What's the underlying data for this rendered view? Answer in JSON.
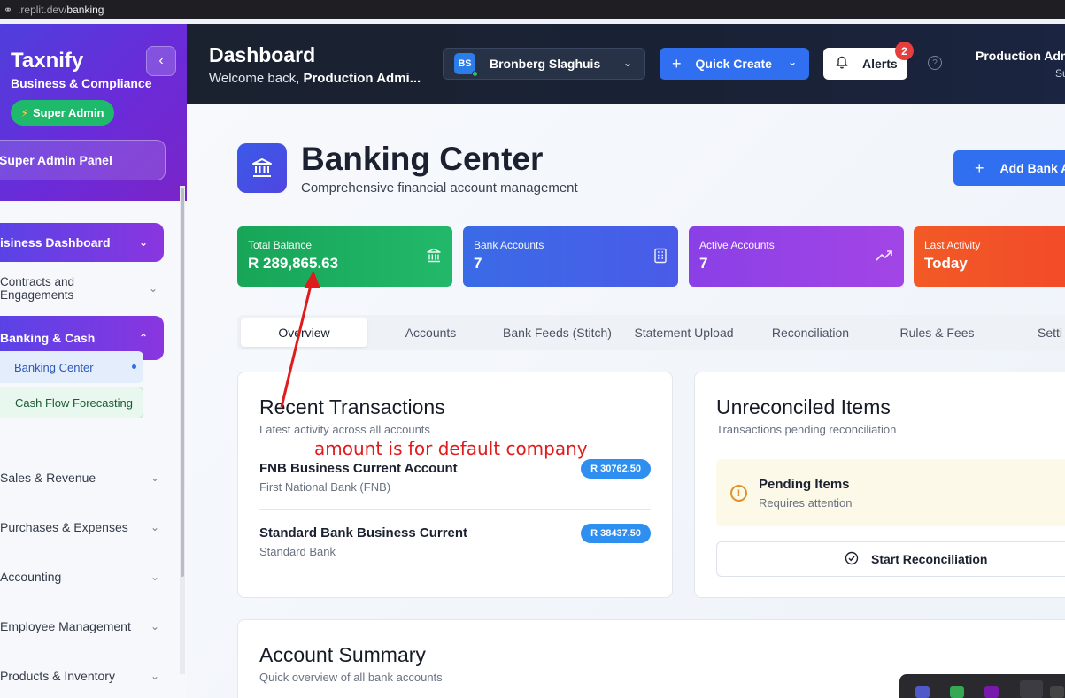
{
  "browser": {
    "url_host": ".replit.dev/",
    "url_path": "banking"
  },
  "sidebar": {
    "brand": "Taxnify",
    "brand_sub": "Business & Compliance",
    "badge": "Super Admin",
    "panel": "Super Admin Panel",
    "items": [
      {
        "label": "isiness Dashboard"
      },
      {
        "label": "Contracts and Engagements"
      },
      {
        "label": "Banking & Cash"
      },
      {
        "label": "Sales & Revenue"
      },
      {
        "label": "Purchases & Expenses"
      },
      {
        "label": "Accounting"
      },
      {
        "label": "Employee Management"
      },
      {
        "label": "Products & Inventory"
      }
    ],
    "sub_items": [
      {
        "label": "Banking Center"
      },
      {
        "label": "Cash Flow Forecasting"
      }
    ]
  },
  "header": {
    "title": "Dashboard",
    "welcome_prefix": "Welcome back, ",
    "welcome_name": "Production Admi...",
    "company_initials": "BS",
    "company_name": "Bronberg Slaghuis",
    "quick_create": "Quick Create",
    "alerts": "Alerts",
    "alert_count": "2",
    "user_name": "Production Adm",
    "user_role": "Su"
  },
  "page": {
    "title": "Banking Center",
    "subtitle": "Comprehensive financial account management",
    "add_button": "Add Bank A"
  },
  "stats": [
    {
      "label": "Total Balance",
      "value": "R 289,865.63",
      "icon": "bank-icon"
    },
    {
      "label": "Bank Accounts",
      "value": "7",
      "icon": "building-icon"
    },
    {
      "label": "Active Accounts",
      "value": "7",
      "icon": "trending-up-icon"
    },
    {
      "label": "Last Activity",
      "value": "Today",
      "icon": "clock-icon"
    }
  ],
  "tabs": [
    {
      "label": "Overview"
    },
    {
      "label": "Accounts"
    },
    {
      "label": "Bank Feeds (Stitch)"
    },
    {
      "label": "Statement Upload"
    },
    {
      "label": "Reconciliation"
    },
    {
      "label": "Rules & Fees"
    },
    {
      "label": "Setti"
    }
  ],
  "recent": {
    "title": "Recent Transactions",
    "subtitle": "Latest activity across all accounts",
    "items": [
      {
        "name": "FNB Business Current Account",
        "bank": "First National Bank (FNB)",
        "amount": "R 30762.50"
      },
      {
        "name": "Standard Bank Business Current",
        "bank": "Standard Bank",
        "amount": "R 38437.50"
      }
    ]
  },
  "unreconciled": {
    "title": "Unreconciled Items",
    "subtitle": "Transactions pending reconciliation",
    "pending_title": "Pending Items",
    "pending_sub": "Requires attention",
    "button": "Start Reconciliation"
  },
  "summary": {
    "title": "Account Summary",
    "subtitle": "Quick overview of all bank accounts"
  },
  "annotation": {
    "text": "amount is for default company",
    "color": "#e01b1b"
  }
}
